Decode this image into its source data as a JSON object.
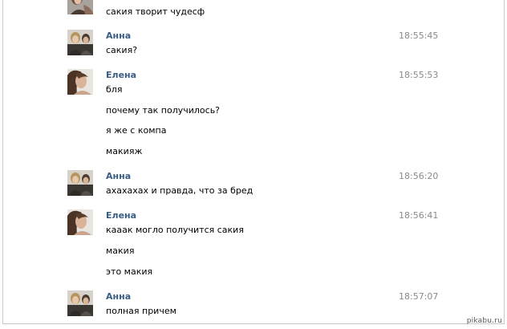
{
  "messages": [
    {
      "author": "",
      "time": "",
      "kind": "photo2",
      "lines": [
        "сакия творит чудесф"
      ]
    },
    {
      "author": "Анна",
      "time": "18:55:45",
      "kind": "group",
      "lines": [
        "сакия?"
      ]
    },
    {
      "author": "Елена",
      "time": "18:55:53",
      "kind": "portrait",
      "lines": [
        "бля",
        "почему так получилось?",
        "я же с компа",
        "макияж"
      ]
    },
    {
      "author": "Анна",
      "time": "18:56:20",
      "kind": "group",
      "lines": [
        "ахахахах и правда, что за бред"
      ]
    },
    {
      "author": "Елена",
      "time": "18:56:41",
      "kind": "portrait",
      "lines": [
        "кааак могло получится сакия",
        "макия",
        "это макия"
      ]
    },
    {
      "author": "Анна",
      "time": "18:57:07",
      "kind": "group",
      "lines": [
        "полная причем"
      ]
    }
  ],
  "watermark": "pikabu.ru"
}
